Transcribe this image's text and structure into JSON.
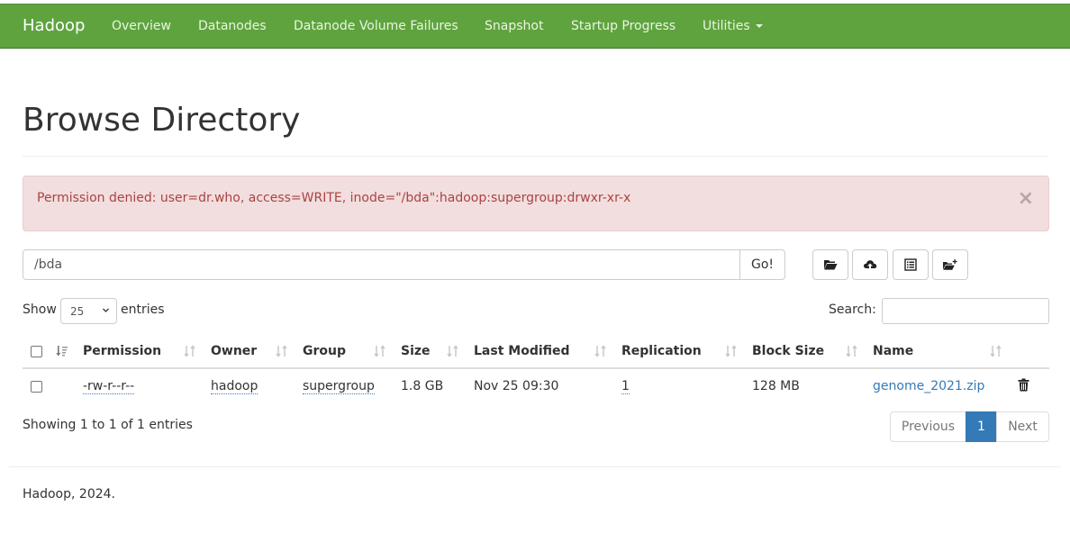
{
  "navbar": {
    "brand": "Hadoop",
    "items": [
      "Overview",
      "Datanodes",
      "Datanode Volume Failures",
      "Snapshot",
      "Startup Progress"
    ],
    "utilities": "Utilities"
  },
  "page": {
    "title": "Browse Directory"
  },
  "alert": {
    "message": "Permission denied: user=dr.who, access=WRITE, inode=\"/bda\":hadoop:supergroup:drwxr-xr-x",
    "close": "×"
  },
  "path_bar": {
    "value": "/bda",
    "go_label": "Go!"
  },
  "toolbar": {
    "icons": [
      "folder-open-icon",
      "upload-cloud-icon",
      "list-icon",
      "new-folder-icon"
    ]
  },
  "table_controls": {
    "show_label": "Show",
    "page_size": "25",
    "entries_label": "entries",
    "search_label": "Search:"
  },
  "table": {
    "columns": [
      "Permission",
      "Owner",
      "Group",
      "Size",
      "Last Modified",
      "Replication",
      "Block Size",
      "Name"
    ],
    "rows": [
      {
        "permission": "-rw-r--r--",
        "owner": "hadoop",
        "group": "supergroup",
        "size": "1.8 GB",
        "last_modified": "Nov 25 09:30",
        "replication": "1",
        "block_size": "128 MB",
        "name": "genome_2021.zip"
      }
    ]
  },
  "pagination": {
    "info": "Showing 1 to 1 of 1 entries",
    "previous": "Previous",
    "current": "1",
    "next": "Next"
  },
  "footer": {
    "text": "Hadoop, 2024."
  },
  "colors": {
    "navbar": "#5fa33e",
    "alert_bg": "#f2dede",
    "alert_text": "#a94442",
    "link": "#337ab7"
  }
}
